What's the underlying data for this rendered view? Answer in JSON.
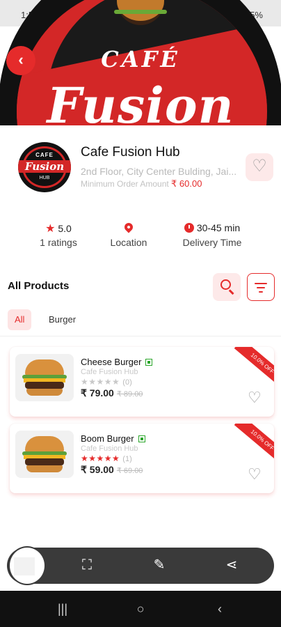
{
  "status_bar": {
    "time": "1:55",
    "right": "5%"
  },
  "hero": {
    "line1": "CAFÉ",
    "line2": "Fusion"
  },
  "logo": {
    "cafe": "CAFE",
    "fusion": "Fusion",
    "hub": "HUB"
  },
  "restaurant": {
    "name": "Cafe Fusion Hub",
    "address": "2nd Floor, City Center Bulding, Jai...",
    "min_order_label": "Minimum Order Amount",
    "min_order_value": "₹ 60.00"
  },
  "info": {
    "rating_value": "5.0",
    "rating_label": "1 ratings",
    "location_label": "Location",
    "delivery_value": "30-45 min",
    "delivery_label": "Delivery Time"
  },
  "products_section": {
    "title": "All Products"
  },
  "chips": [
    "All",
    "Burger"
  ],
  "products": [
    {
      "name": "Cheese Burger",
      "restaurant": "Cafe Fusion Hub",
      "rating_count": "(0)",
      "price": "₹ 79.00",
      "old_price": "₹ 89.00",
      "ribbon": "10.0% OFF",
      "stars_color": "#c8c8c8"
    },
    {
      "name": "Boom Burger",
      "restaurant": "Cafe Fusion Hub",
      "rating_count": "(1)",
      "price": "₹ 59.00",
      "old_price": "₹ 69.00",
      "ribbon": "10.0% OFF",
      "stars_color": "#e52b2b"
    }
  ],
  "colors": {
    "accent": "#e52b2b",
    "accent_light": "#fde9e9"
  }
}
